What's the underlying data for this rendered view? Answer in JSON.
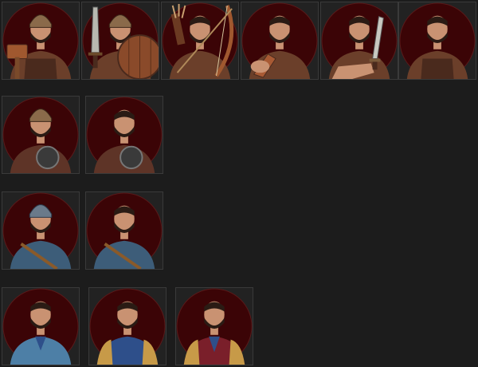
{
  "colors": {
    "background": "#1c1c1c",
    "tile_border": "#3a3a3a",
    "medallion": "#3b0406",
    "medallion_edge": "#5a1a1a",
    "skin": "#c99272",
    "hair": "#2a1b14",
    "leather_brown": "#6b3f2a",
    "tunic_brown": "#5e3427",
    "mail_blue": "#3d5d79",
    "tunic_blue": "#2e4f8a",
    "tunic_lightblue": "#4d7fa6",
    "tunic_red": "#7a1f2a",
    "gold_trim": "#c79a48"
  },
  "rows": [
    {
      "portraits": [
        {
          "id": "soldier-helmet-hammer",
          "icons": [
            "helmet-icon",
            "war-hammer-icon"
          ]
        },
        {
          "id": "soldier-helmet-sword-shield",
          "icons": [
            "helmet-icon",
            "sword-icon",
            "round-shield-icon"
          ]
        },
        {
          "id": "archer-bow-quiver",
          "icons": [
            "bow-icon",
            "quiver-icon"
          ]
        },
        {
          "id": "soldier-club",
          "icons": [
            "club-icon"
          ]
        },
        {
          "id": "soldier-dagger",
          "icons": [
            "dagger-icon"
          ]
        },
        {
          "id": "soldier-unarmed",
          "icons": []
        }
      ]
    },
    {
      "portraits": [
        {
          "id": "soldier-helmet-breastplate",
          "icons": [
            "helmet-icon",
            "breastplate-icon"
          ]
        },
        {
          "id": "soldier-breastplate",
          "icons": [
            "breastplate-icon"
          ]
        }
      ]
    },
    {
      "portraits": [
        {
          "id": "soldier-helmet-scale-armor",
          "icons": [
            "helmet-icon",
            "scale-armor-icon"
          ]
        },
        {
          "id": "soldier-scale-armor",
          "icons": [
            "scale-armor-icon"
          ]
        }
      ]
    },
    {
      "portraits": [
        {
          "id": "noble-light-blue-tunic",
          "icons": [
            "tunic-icon"
          ]
        },
        {
          "id": "noble-blue-tunic",
          "icons": [
            "tunic-icon"
          ]
        },
        {
          "id": "noble-red-tunic",
          "icons": [
            "tunic-icon"
          ]
        }
      ]
    }
  ]
}
